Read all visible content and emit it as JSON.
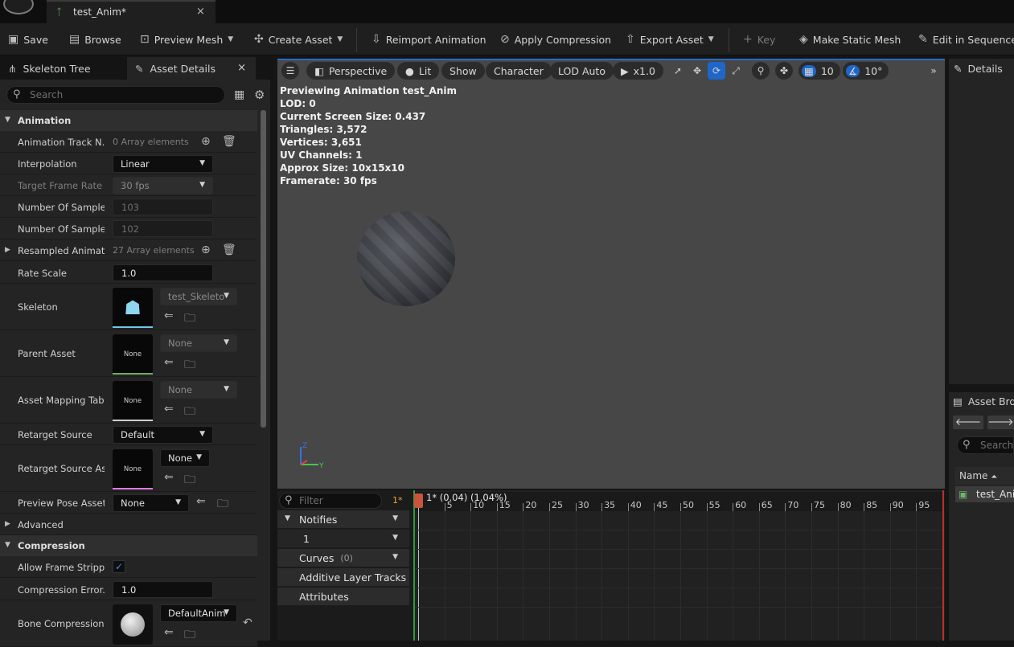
{
  "window": {
    "tab_title": "test_Anim*",
    "close": "×"
  },
  "toolbar": {
    "save": "Save",
    "browse": "Browse",
    "preview_mesh": "Preview Mesh",
    "create_asset": "Create Asset",
    "reimport": "Reimport Animation",
    "apply_compression": "Apply Compression",
    "export_asset": "Export Asset",
    "key": "Key",
    "make_static_mesh": "Make Static Mesh",
    "edit_in_sequencer": "Edit in Sequencer"
  },
  "panels": {
    "skeleton_tree": "Skeleton Tree",
    "asset_details": "Asset Details",
    "details": "Details",
    "asset_browser": "Asset Bro",
    "close": "×"
  },
  "search": {
    "placeholder": "Search"
  },
  "animation": {
    "category": "Animation",
    "rows": [
      {
        "name": "Animation Track N...",
        "value": "0 Array elements"
      },
      {
        "name": "Interpolation",
        "value": "Linear"
      },
      {
        "name": "Target Frame Rate",
        "value": "30 fps"
      },
      {
        "name": "Number Of Sample...",
        "value": "103"
      },
      {
        "name": "Number Of Sample...",
        "value": "102"
      },
      {
        "name": "Resampled Animati...",
        "value": "27 Array elements"
      },
      {
        "name": "Rate Scale",
        "value": "1.0"
      },
      {
        "name": "Skeleton",
        "value": "test_Skeleto"
      },
      {
        "name": "Parent Asset",
        "value": "None",
        "thumb": "None"
      },
      {
        "name": "Asset Mapping Table",
        "value": "None",
        "thumb": "None"
      },
      {
        "name": "Retarget Source",
        "value": "Default"
      },
      {
        "name": "Retarget Source As...",
        "value": "None",
        "thumb": "None"
      },
      {
        "name": "Preview Pose Asset",
        "value": "None"
      }
    ],
    "advanced": "Advanced"
  },
  "compression": {
    "category": "Compression",
    "rows": [
      {
        "name": "Allow Frame Strippi...",
        "value": "✓"
      },
      {
        "name": "Compression Error...",
        "value": "1.0"
      },
      {
        "name": "Bone Compression...",
        "value": "DefaultAnim"
      }
    ]
  },
  "viewport": {
    "perspective": "Perspective",
    "lit": "Lit",
    "show": "Show",
    "character": "Character",
    "lod": "LOD Auto",
    "speed": "x1.0",
    "grid": "10",
    "angle": "10°",
    "stats": [
      "Previewing Animation test_Anim",
      "LOD: 0",
      "Current Screen Size: 0.437",
      "Triangles: 3,572",
      "Vertices: 3,651",
      "UV Channels: 1",
      "Approx Size: 10x15x10",
      "Framerate: 30 fps"
    ]
  },
  "timeline": {
    "filter_placeholder": "Filter",
    "modified": "1*",
    "current": "1* (0.04) (1.04%)",
    "tracks": {
      "notifies": "Notifies",
      "notify_row": "1",
      "curves": "Curves",
      "curves_count": "(0)",
      "additive": "Additive Layer Tracks",
      "attributes": "Attributes"
    },
    "ticks": [
      "5",
      "10",
      "15",
      "20",
      "25",
      "30",
      "35",
      "40",
      "45",
      "50",
      "55",
      "60",
      "65",
      "70",
      "75",
      "80",
      "85",
      "90",
      "95"
    ]
  },
  "asset_browser": {
    "search_placeholder": "Search",
    "col_name": "Name",
    "item": "test_Ani"
  }
}
